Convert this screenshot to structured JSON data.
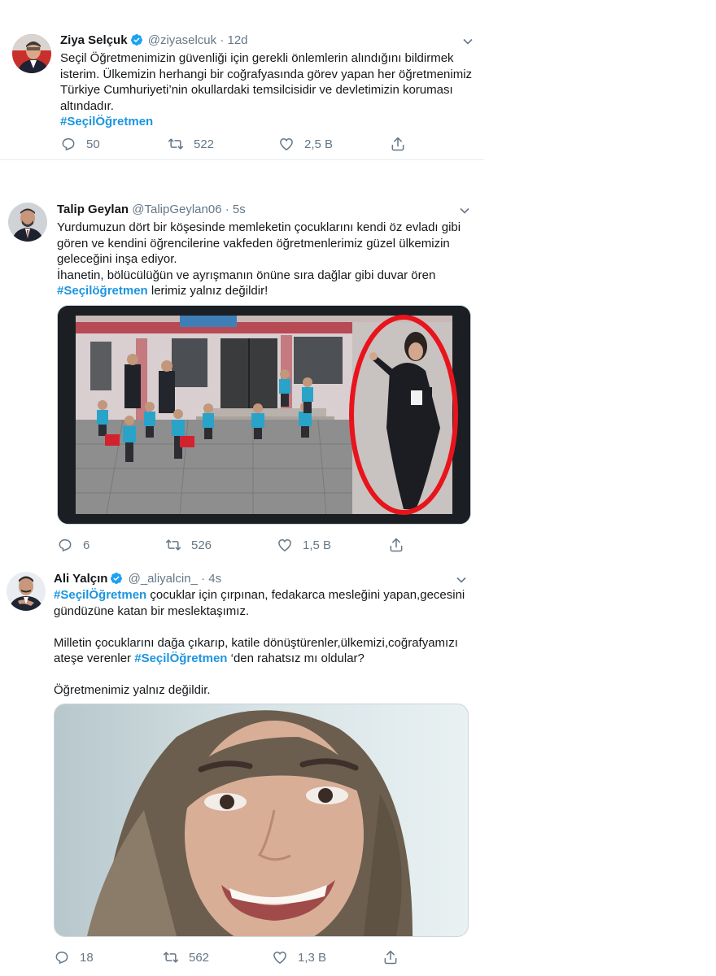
{
  "tweets": [
    {
      "name": "Ziya Selçuk",
      "handle": "@ziyaselcuk",
      "separator": "·",
      "time": "12d",
      "verified": true,
      "lines": [
        "Seçil Öğretmenimizin güvenliği için gerekli önlemlerin alındığını bildirmek",
        "isterim. Ülkemizin herhangi bir coğrafyasında görev yapan her öğretmenimiz",
        "Türkiye Cumhuriyeti’nin okullardaki temsilcisidir ve devletimizin koruması",
        "altındadır."
      ],
      "hashtag": "#SeçilÖğretmen",
      "replies": "50",
      "retweets": "522",
      "likes": "2,5 B"
    },
    {
      "name": "Talip Geylan",
      "handle": "@TalipGeylan06",
      "separator": "·",
      "time": "5s",
      "verified": false,
      "lines": [
        "Yurdumuzun dört bir köşesinde memleketin çocuklarını kendi öz evladı gibi",
        "gören ve kendini öğrencilerine vakfeden öğretmenlerimiz güzel ülkemizin",
        "geleceğini inşa ediyor.",
        "İhanetin, bölücülüğün ve ayrışmanın önüne sıra dağlar gibi duvar ören"
      ],
      "hashtag": "#Seçilöğretmen",
      "after_hashtag": " lerimiz yalnız değildir!",
      "replies": "6",
      "retweets": "526",
      "likes": "1,5 B"
    },
    {
      "name": "Ali Yalçın",
      "handle": "@_aliyalcin_",
      "separator": "·",
      "time": "4s",
      "verified": true,
      "hashtag1": "#SeçilÖğretmen",
      "line1_after": " çocuklar için çırpınan, fedakarca mesleğini yapan,gecesini",
      "line2": "gündüzüne katan bir meslektaşımız.",
      "line3": "Milletin çocuklarını dağa çıkarıp, katile dönüştürenler,ülkemizi,coğrafyamızı",
      "line4_before": "ateşe verenler ",
      "hashtag2": "#SeçilÖğretmen",
      "line4_after": " ‘den rahatsız mı oldular?",
      "line5": "Öğretmenimiz yalnız değildir.",
      "replies": "18",
      "retweets": "562",
      "likes": "1,3 B"
    }
  ],
  "icons": {
    "reply": "reply-icon",
    "retweet": "retweet-icon",
    "like": "heart-icon",
    "share": "share-icon",
    "caret": "chevron-down-icon",
    "verified": "verified-badge-icon"
  },
  "colors": {
    "link": "#1b95e0",
    "muted": "#657786",
    "text": "#14171a",
    "border": "#e6ecf0",
    "highlight_circle": "#e8141c"
  }
}
